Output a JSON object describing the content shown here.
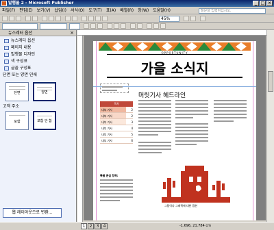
{
  "window": {
    "title": "발행물 2 - Microsoft Publisher"
  },
  "menubar": [
    "파일(F)",
    "편집(E)",
    "보기(V)",
    "삽입(I)",
    "서식(O)",
    "도구(T)",
    "표(A)",
    "배열(R)",
    "창(W)",
    "도움말(H)"
  ],
  "help_placeholder": "질문을 입력하십시오.",
  "toolbar": {
    "zoom": "45%"
  },
  "left_panel": {
    "title": "뉴스레터 옵션",
    "items": [
      "뉴스레터 옵션",
      "페이지 내용",
      "발행물 디자인",
      "색 구성표",
      "글꼴 구성표"
    ],
    "section_one_or_two": "단면 또는 양면 인쇄",
    "opt_single": "단면",
    "opt_double": "양면",
    "section_address": "고객 주소",
    "opt_none": "포함",
    "opt_include": "포함 안 함",
    "convert_button": "웹 레이아웃으로 변환..."
  },
  "publication": {
    "kicker": "OPPORTUNITY",
    "masthead": "가을 소식지",
    "headline": "머릿기사 헤드라인",
    "sidebar_head": "목차",
    "sidebar_rows": [
      {
        "label": "내부 기사",
        "num": "2"
      },
      {
        "label": "내부 기사",
        "num": "2"
      },
      {
        "label": "내부 기사",
        "num": "3"
      },
      {
        "label": "내부 기사",
        "num": "4"
      },
      {
        "label": "내부 기사",
        "num": "5"
      },
      {
        "label": "내부 기사",
        "num": "6"
      }
    ],
    "highlights_title": "특별 관심 항목:",
    "caption": "그림이나 그래픽에 대한 캡션"
  },
  "status": {
    "pages": [
      "1",
      "2",
      "3",
      "4"
    ],
    "coords": "-1.696, 21.784 cm"
  }
}
